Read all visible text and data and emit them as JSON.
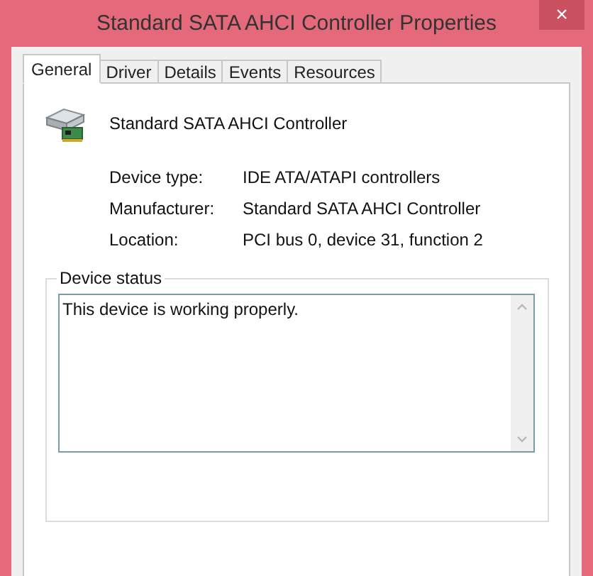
{
  "window": {
    "title": "Standard SATA AHCI Controller Properties",
    "close": "×"
  },
  "tabs": [
    {
      "label": "General",
      "selected": true
    },
    {
      "label": "Driver",
      "selected": false
    },
    {
      "label": "Details",
      "selected": false
    },
    {
      "label": "Events",
      "selected": false
    },
    {
      "label": "Resources",
      "selected": false
    }
  ],
  "device": {
    "name": "Standard SATA AHCI Controller"
  },
  "properties": [
    {
      "label": "Device type:",
      "value": "IDE ATA/ATAPI controllers"
    },
    {
      "label": "Manufacturer:",
      "value": "Standard SATA AHCI Controller"
    },
    {
      "label": "Location:",
      "value": "PCI bus 0, device 31, function 2"
    }
  ],
  "device_status": {
    "title": "Device status",
    "value": "This device is working properly."
  }
}
